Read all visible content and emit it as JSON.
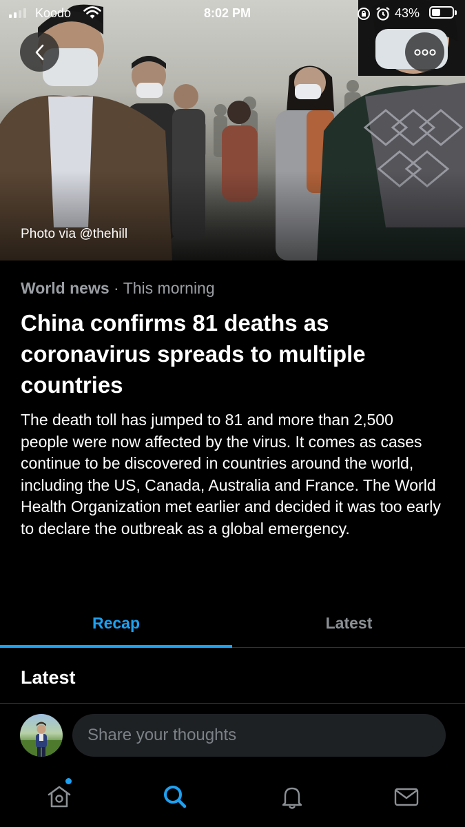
{
  "status_bar": {
    "carrier": "Koodo",
    "time": "8:02 PM",
    "battery_percent": "43%",
    "battery_level": 0.43,
    "icons": [
      "signal-icon",
      "wifi-icon",
      "rotation-lock-icon",
      "alarm-icon",
      "battery-icon"
    ]
  },
  "hero": {
    "photo_credit": "Photo via @thehill",
    "back_icon": "chevron-left-icon",
    "more_icon": "more-dots-icon"
  },
  "article": {
    "category": "World news",
    "separator": "·",
    "time": "This morning",
    "headline": "China confirms 81 deaths as coronavirus spreads to multiple countries",
    "summary": "The death toll has jumped to 81 and more than 2,500 people were now affected by the virus. It comes as cases continue to be discovered in countries around the world, including the US, Canada, Australia and France. The World Health Organization met earlier and decided it was too early to declare the outbreak as a global emergency."
  },
  "tabs": [
    {
      "label": "Recap",
      "active": true
    },
    {
      "label": "Latest",
      "active": false
    }
  ],
  "section": {
    "title": "Latest"
  },
  "composer": {
    "placeholder": "Share your thoughts"
  },
  "bottom_nav": [
    {
      "name": "home",
      "icon": "home-icon",
      "has_badge": true
    },
    {
      "name": "search",
      "icon": "search-icon",
      "active": true
    },
    {
      "name": "notifications",
      "icon": "bell-icon"
    },
    {
      "name": "messages",
      "icon": "mail-icon"
    }
  ],
  "colors": {
    "accent": "#1da1f2",
    "background": "#000000",
    "muted_text": "#9b9fa4",
    "divider": "#2f3336",
    "input_bg": "#1e2124"
  }
}
